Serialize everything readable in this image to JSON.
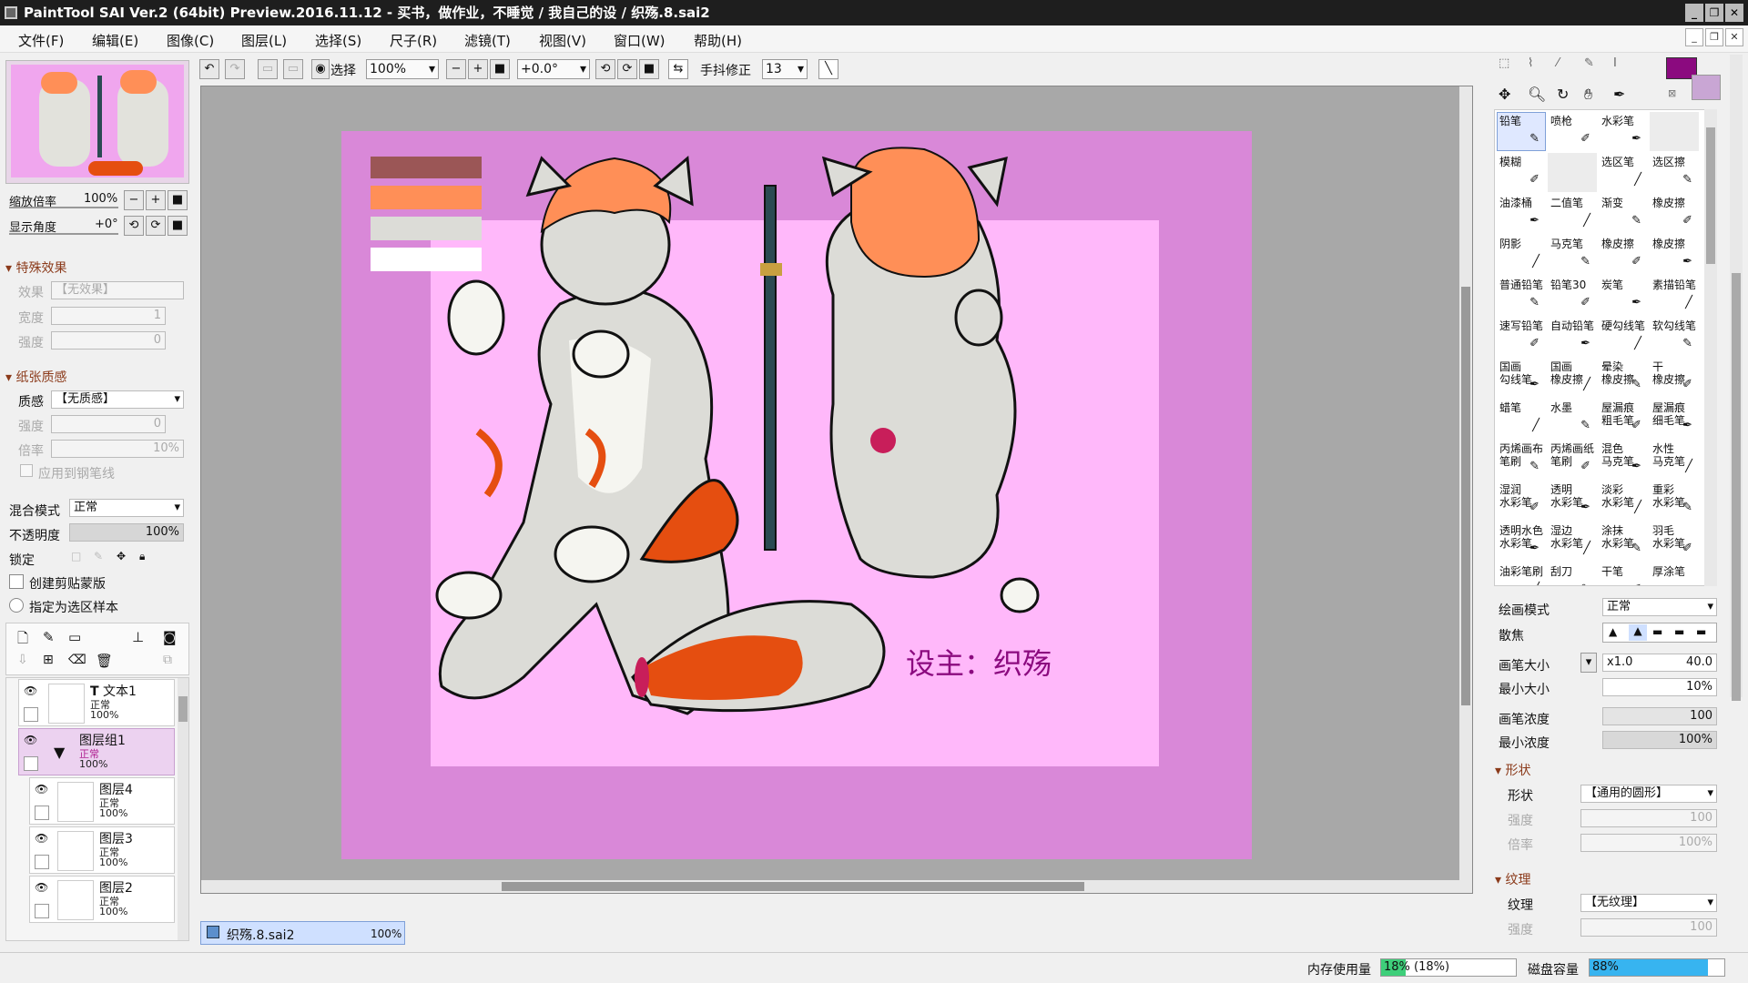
{
  "window": {
    "title": "PaintTool SAI Ver.2 (64bit) Preview.2016.11.12 - 买书，做作业，不睡觉 / 我自己的设 / 织殇.8.sai2"
  },
  "menu": [
    "文件(F)",
    "编辑(E)",
    "图像(C)",
    "图层(L)",
    "选择(S)",
    "尺子(R)",
    "滤镜(T)",
    "视图(V)",
    "窗口(W)",
    "帮助(H)"
  ],
  "toolbar": {
    "select_label": "选择",
    "zoom": "100%",
    "angle": "+0.0°",
    "stabilizer_label": "手抖修正",
    "stabilizer_value": "13"
  },
  "navigator": {
    "zoom_label": "缩放倍率",
    "zoom_value": "100%",
    "angle_label": "显示角度",
    "angle_value": "+0°"
  },
  "effects": {
    "section": "特殊效果",
    "effect_label": "效果",
    "effect_value": "【无效果】",
    "width_label": "宽度",
    "width_value": "1",
    "strength_label": "强度",
    "strength_value": "0"
  },
  "paper": {
    "section": "纸张质感",
    "texture_label": "质感",
    "texture_value": "【无质感】",
    "strength_label": "强度",
    "strength_value": "0",
    "rate_label": "倍率",
    "rate_value": "10%",
    "apply_label": "应用到钢笔线"
  },
  "layerprops": {
    "blend_label": "混合模式",
    "blend_value": "正常",
    "opacity_label": "不透明度",
    "opacity_value": "100%",
    "opacity_fraction": 1.0,
    "lock_label": "锁定",
    "clip_label": "创建剪贴蒙版",
    "sample_label": "指定为选区样本"
  },
  "layers": [
    {
      "name": "文本1",
      "mode": "正常",
      "opacity": "100%",
      "prefix": "T"
    },
    {
      "name": "图层组1",
      "mode": "正常",
      "opacity": "100%"
    },
    {
      "name": "图层4",
      "mode": "正常",
      "opacity": "100%"
    },
    {
      "name": "图层3",
      "mode": "正常",
      "opacity": "100%"
    },
    {
      "name": "图层2",
      "mode": "正常",
      "opacity": "100%"
    }
  ],
  "canvas": {
    "watermark": "设主：织殇",
    "swatches": [
      "#9b5656",
      "#ff8f57",
      "#dcdcd7",
      "#ffffff"
    ]
  },
  "tab": {
    "name": "织殇.8.sai2",
    "zoom": "100%"
  },
  "tools": [
    [
      "铅笔",
      "喷枪",
      "水彩笔",
      ""
    ],
    [
      "模糊",
      "",
      "选区笔",
      "选区擦"
    ],
    [
      "油漆桶",
      "二值笔",
      "渐变",
      "橡皮擦"
    ],
    [
      "阴影",
      "马克笔",
      "橡皮擦",
      "橡皮擦"
    ],
    [
      "普通铅笔",
      "铅笔30",
      "炭笔",
      "素描铅笔"
    ],
    [
      "速写铅笔",
      "自动铅笔",
      "硬勾线笔",
      "软勾线笔"
    ],
    [
      "国画 勾线笔",
      "国画 橡皮擦",
      "晕染 橡皮擦",
      "干 橡皮擦"
    ],
    [
      "蜡笔",
      "水墨",
      "屋漏痕 粗毛笔",
      "屋漏痕 细毛笔"
    ],
    [
      "丙烯画布 笔刷",
      "丙烯画纸 笔刷",
      "混色 马克笔",
      "水性 马克笔"
    ],
    [
      "湿润 水彩笔",
      "透明 水彩笔",
      "淡彩 水彩笔",
      "重彩 水彩笔"
    ],
    [
      "透明水色 水彩笔",
      "湿边 水彩笔",
      "涂抹 水彩笔",
      "羽毛 水彩笔"
    ],
    [
      "油彩笔刷",
      "刮刀",
      "干笔",
      "厚涂笔"
    ]
  ],
  "brush": {
    "mode_label": "绘画模式",
    "mode_value": "正常",
    "blur_label": "散焦",
    "size_label": "画笔大小",
    "size_mult": "x1.0",
    "size_value": "40.0",
    "minsize_label": "最小大小",
    "minsize_value": "10%",
    "density_label": "画笔浓度",
    "density_value": "100",
    "mindensity_label": "最小浓度",
    "mindensity_value": "100%",
    "shape_section": "形状",
    "shape_label": "形状",
    "shape_value": "【通用的圆形】",
    "shape_strength_label": "强度",
    "shape_strength_value": "100",
    "shape_rate_label": "倍率",
    "shape_rate_value": "100%",
    "texture_section": "纹理",
    "texture_label": "纹理",
    "texture_value": "【无纹理】",
    "texture_strength_label": "强度",
    "texture_strength_value": "100"
  },
  "colors": {
    "primary": "#8b0a7f",
    "secondary": "#c9a6d4",
    "accent": "#ff8f57",
    "bg_pink": "#d988d8",
    "inner_pink": "#ffb8fa"
  },
  "status": {
    "mem_label": "内存使用量",
    "mem_value": "18% (18%)",
    "mem_fraction": 0.18,
    "disk_label": "磁盘容量",
    "disk_value": "88%",
    "disk_fraction": 0.88
  }
}
